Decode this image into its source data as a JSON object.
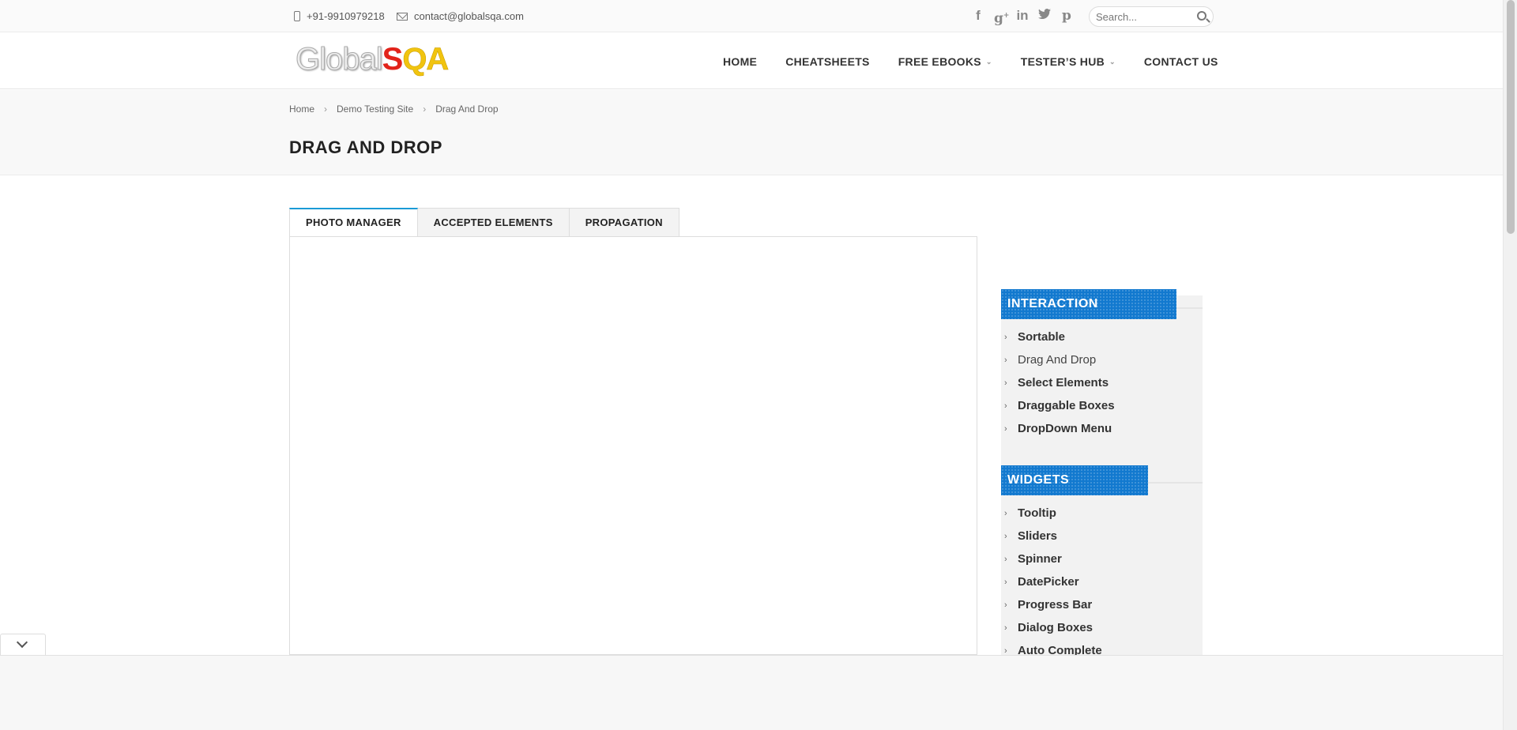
{
  "topbar": {
    "phone": "+91-9910979218",
    "email": "contact@globalsqa.com",
    "socials": [
      "facebook-icon",
      "google-plus-icon",
      "linkedin-icon",
      "twitter-icon",
      "pinterest-icon"
    ],
    "search_placeholder": "Search..."
  },
  "logo": {
    "part1": "Global",
    "part2": "S",
    "part3": "QA"
  },
  "nav": [
    {
      "label": "HOME"
    },
    {
      "label": "CHEATSHEETS"
    },
    {
      "label": "FREE EBOOKS"
    },
    {
      "label": "TESTER’S HUB"
    },
    {
      "label": "CONTACT US"
    }
  ],
  "breadcrumb": [
    "Home",
    "Demo Testing Site",
    "Drag And Drop"
  ],
  "page_title": "DRAG AND DROP",
  "tabs": [
    {
      "label": "PHOTO MANAGER"
    },
    {
      "label": "ACCEPTED ELEMENTS"
    },
    {
      "label": "PROPAGATION"
    }
  ],
  "sidebar": {
    "interaction": {
      "title": "INTERACTION",
      "items": [
        "Sortable",
        "Drag And Drop",
        "Select Elements",
        "Draggable Boxes",
        "DropDown Menu"
      ]
    },
    "widgets": {
      "title": "WIDGETS",
      "items": [
        "Tooltip",
        "Sliders",
        "Spinner",
        "DatePicker",
        "Progress Bar",
        "Dialog Boxes",
        "Auto Complete"
      ]
    }
  },
  "colors": {
    "accent": "#1a9ad6",
    "widget_blue": "#1279cf"
  }
}
